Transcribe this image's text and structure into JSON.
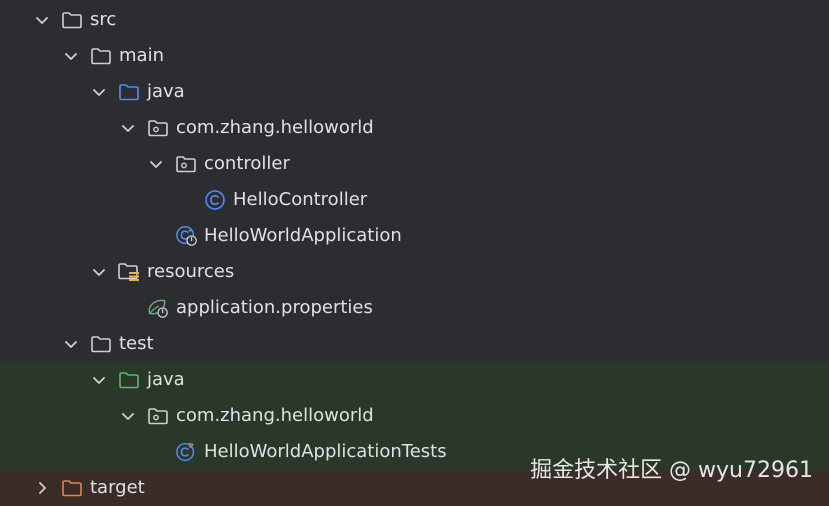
{
  "tree": {
    "nodes": [
      {
        "label": "src"
      },
      {
        "label": "main"
      },
      {
        "label": "java"
      },
      {
        "label": "com.zhang.helloworld"
      },
      {
        "label": "controller"
      },
      {
        "label": "HelloController"
      },
      {
        "label": "HelloWorldApplication"
      },
      {
        "label": "resources"
      },
      {
        "label": "application.properties"
      },
      {
        "label": "test"
      },
      {
        "label": "java"
      },
      {
        "label": "com.zhang.helloworld"
      },
      {
        "label": "HelloWorldApplicationTests"
      },
      {
        "label": "target"
      }
    ]
  },
  "watermark": {
    "text": "掘金技术社区 @ wyu72961"
  },
  "colors": {
    "background": "#2b2d30",
    "test_highlight": "#293828",
    "target_highlight": "#3a2c27",
    "folder_blue": "#548af7",
    "folder_green": "#5fb865",
    "class_blue": "#548af7",
    "text": "#dfe1e5",
    "icon_gray": "#ced0d6",
    "spring_green": "#6aab73"
  },
  "icons": [
    "chevron-down-icon",
    "chevron-right-icon",
    "folder-icon",
    "source-folder-icon",
    "test-source-folder-icon",
    "package-icon",
    "class-icon",
    "spring-boot-app-icon",
    "resources-folder-icon",
    "properties-file-icon",
    "test-class-icon"
  ]
}
